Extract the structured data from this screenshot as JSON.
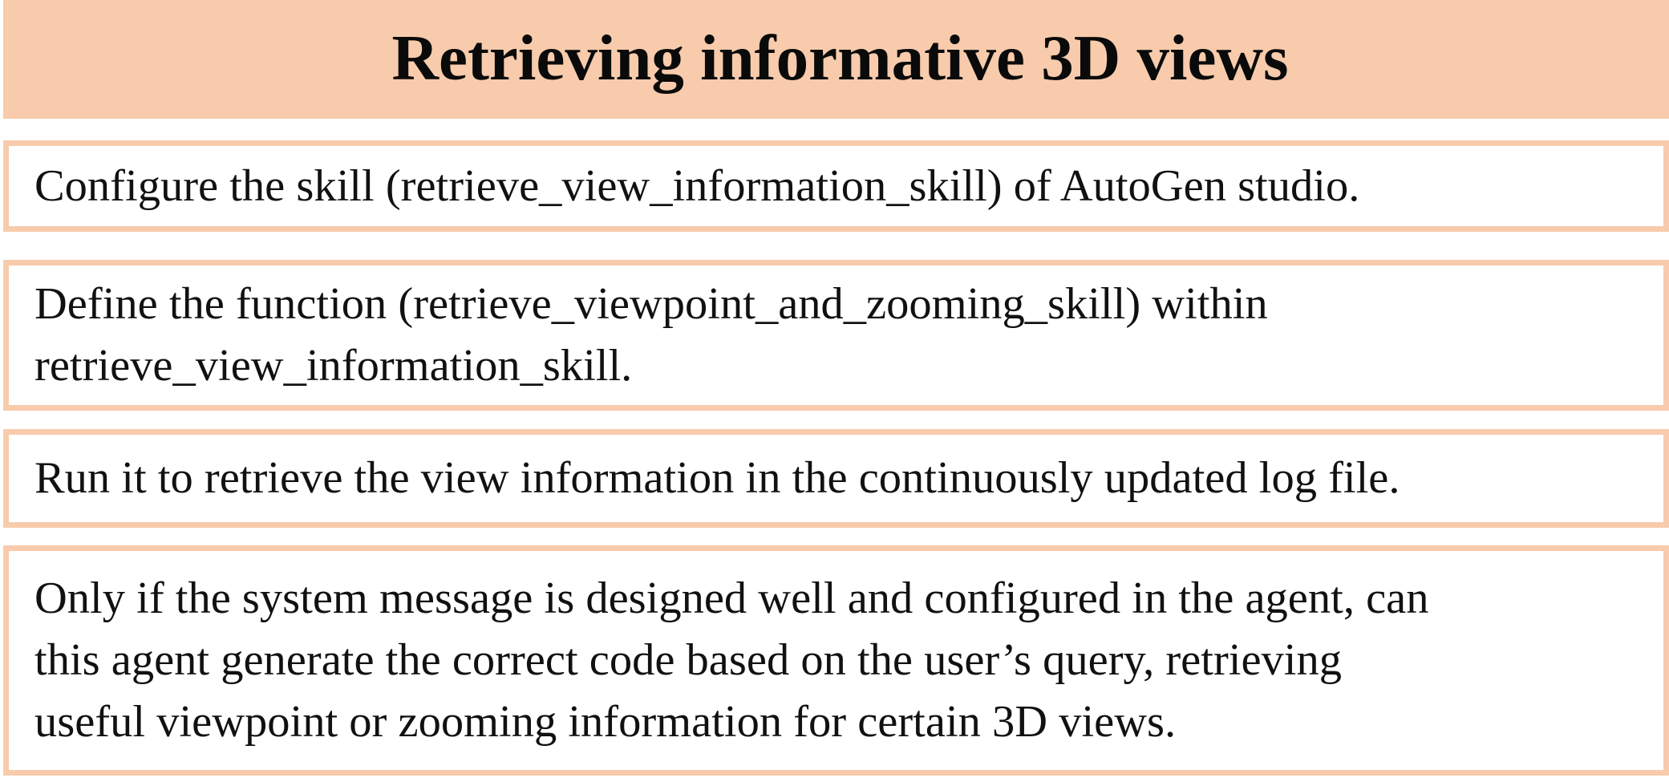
{
  "header": {
    "title": "Retrieving informative 3D views"
  },
  "steps": [
    {
      "text": "Configure the skill (retrieve_view_information_skill) of AutoGen studio."
    },
    {
      "text": "Define the function (retrieve_viewpoint_and_zooming_skill) within\nretrieve_view_information_skill."
    },
    {
      "text": "Run it to retrieve the view information in the continuously updated log file."
    },
    {
      "text": "Only if the system message is designed well and configured in the agent, can\nthis agent generate the correct code based on the user’s query, retrieving\nuseful viewpoint or zooming information for certain 3D views."
    }
  ],
  "colors": {
    "header_background": "#f7cbac",
    "box_border": "#f7cbac",
    "text": "#111111"
  }
}
